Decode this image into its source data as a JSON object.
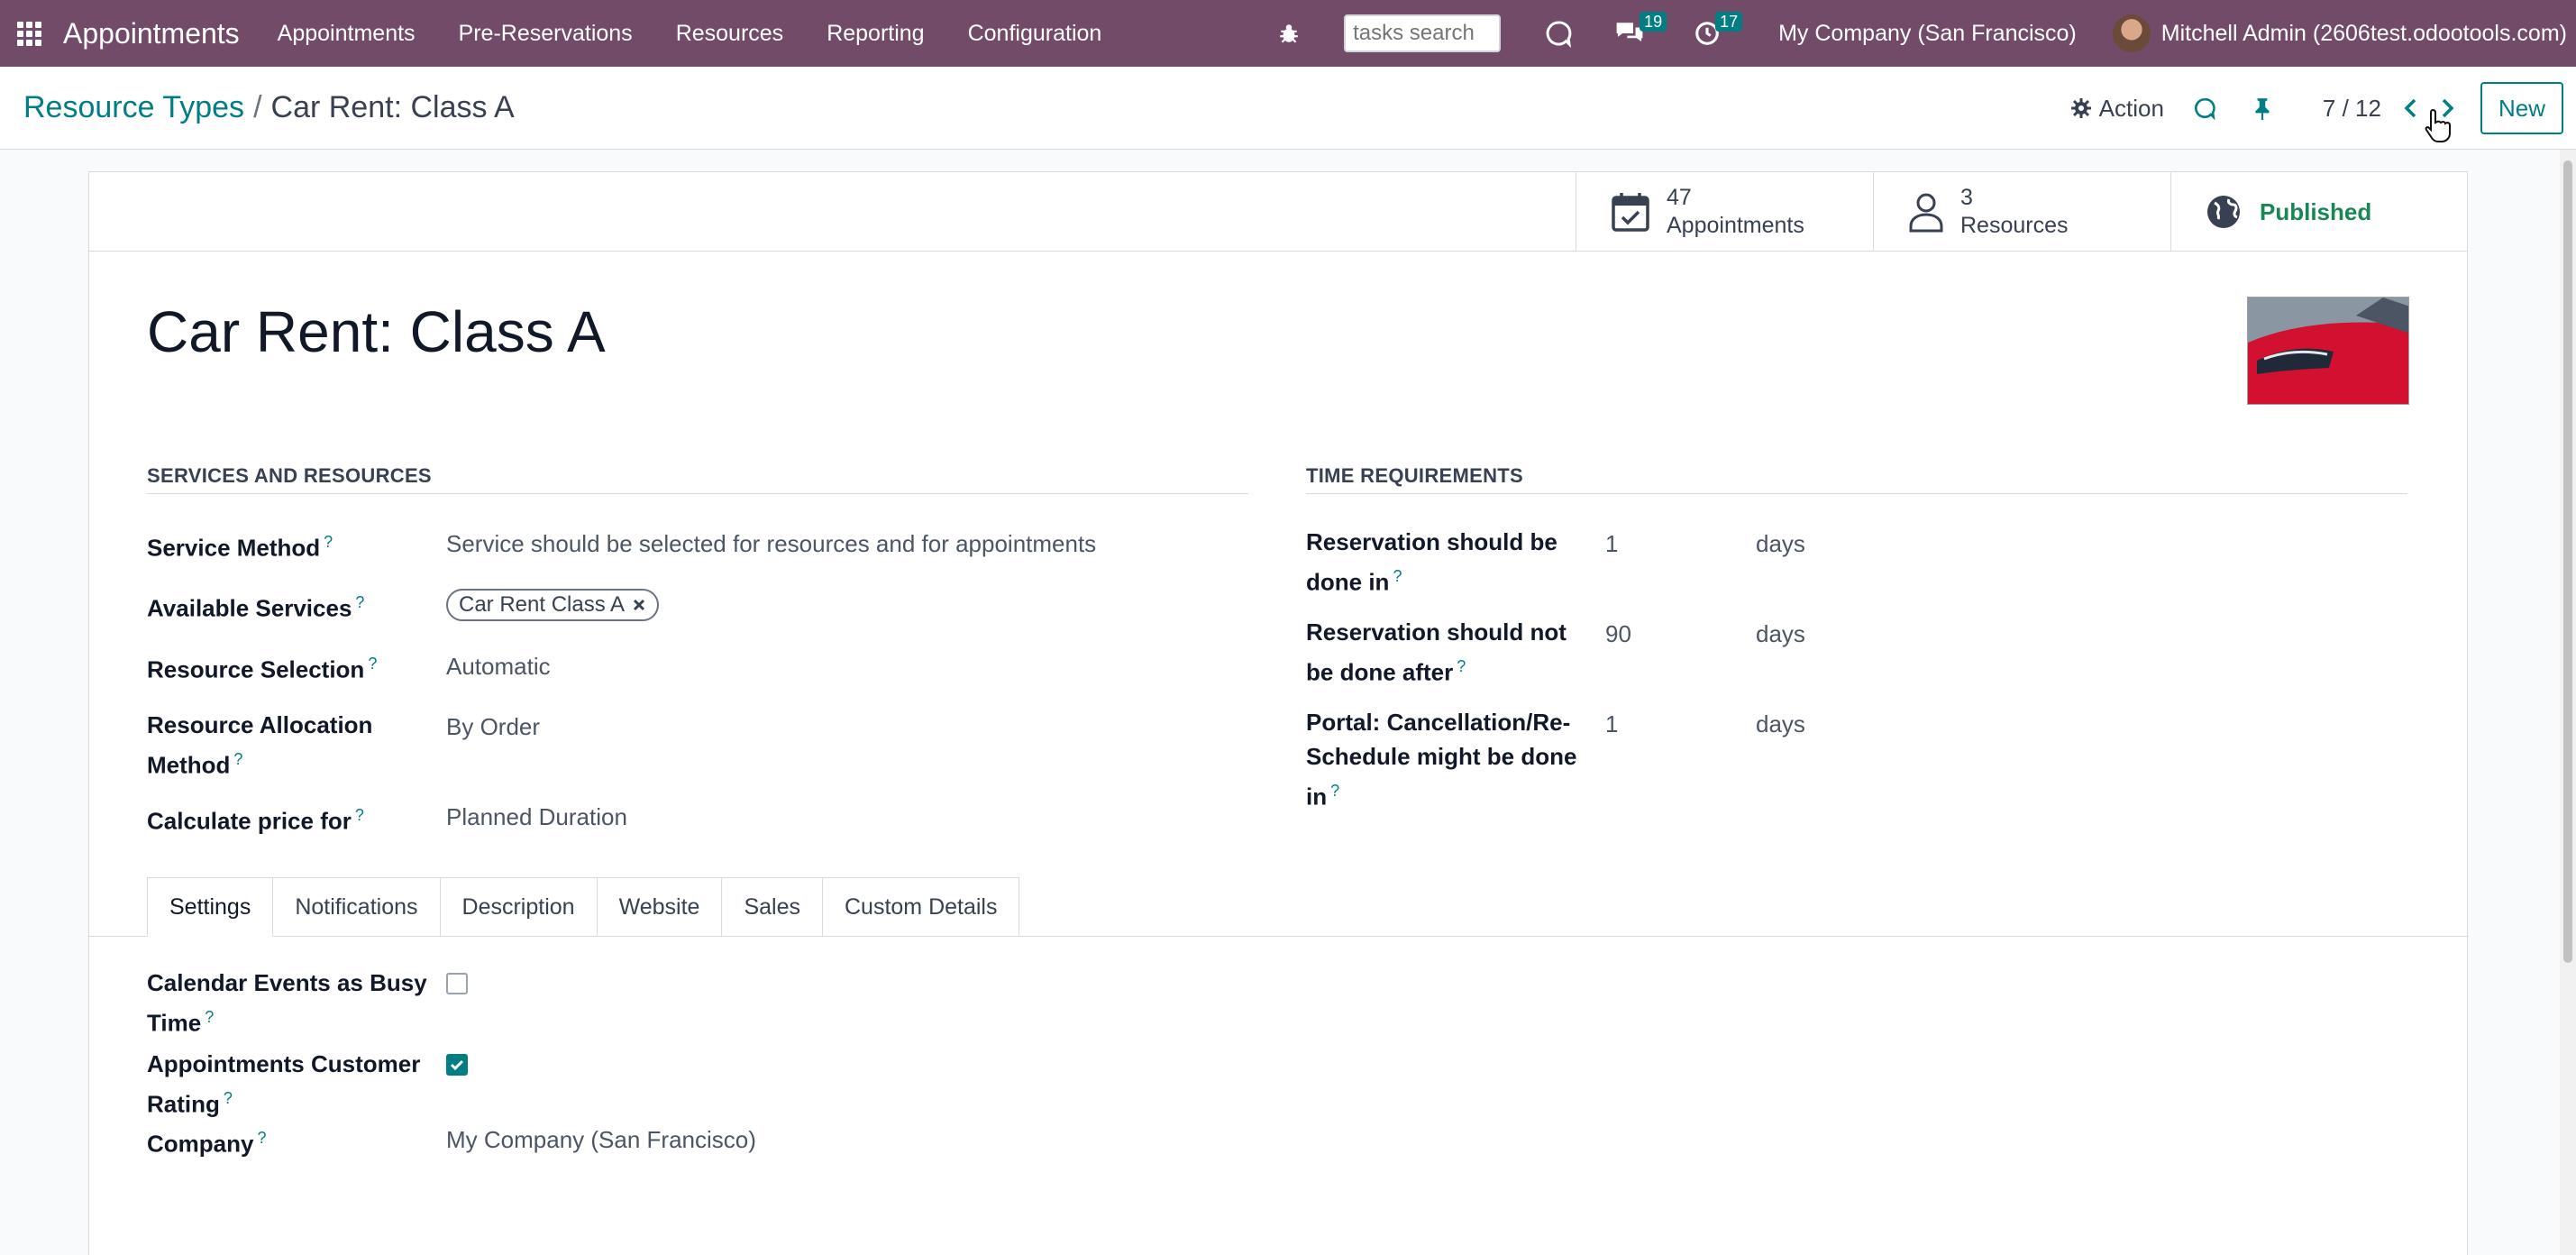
{
  "navbar": {
    "brand": "Appointments",
    "menu": [
      "Appointments",
      "Pre-Reservations",
      "Resources",
      "Reporting",
      "Configuration"
    ],
    "search_placeholder": "tasks search",
    "messages_count": "19",
    "activities_count": "17",
    "company": "My Company (San Francisco)",
    "user": "Mitchell Admin (2606test.odootools.com)"
  },
  "control": {
    "breadcrumb_parent": "Resource Types",
    "breadcrumb_sep": "/",
    "breadcrumb_current": "Car Rent: Class A",
    "action_label": "Action",
    "pager": "7 / 12",
    "new_label": "New"
  },
  "stats": {
    "appointments_count": "47",
    "appointments_label": "Appointments",
    "resources_count": "3",
    "resources_label": "Resources",
    "published_label": "Published"
  },
  "record": {
    "title": "Car Rent: Class A"
  },
  "services": {
    "heading": "SERVICES AND RESOURCES",
    "service_method_label": "Service Method",
    "service_method_value": "Service should be selected for resources and for appointments",
    "available_services_label": "Available Services",
    "available_services_tag": "Car Rent Class A",
    "resource_selection_label": "Resource Selection",
    "resource_selection_value": "Automatic",
    "allocation_label_1": "Resource Allocation",
    "allocation_label_2": "Method",
    "allocation_value": "By Order",
    "price_label": "Calculate price for",
    "price_value": "Planned Duration"
  },
  "time": {
    "heading": "TIME REQUIREMENTS",
    "res_done_in_1": "Reservation should be",
    "res_done_in_2": "done in",
    "res_done_in_value": "1",
    "res_not_after_1": "Reservation should not",
    "res_not_after_2": "be done after",
    "res_not_after_value": "90",
    "portal_1": "Portal: Cancellation/Re-",
    "portal_2": "Schedule might be done",
    "portal_3": "in",
    "portal_value": "1",
    "unit": "days"
  },
  "tabs": [
    "Settings",
    "Notifications",
    "Description",
    "Website",
    "Sales",
    "Custom Details"
  ],
  "settings": {
    "calendar_busy_1": "Calendar Events as Busy",
    "calendar_busy_2": "Time",
    "calendar_busy_checked": false,
    "rating_1": "Appointments Customer",
    "rating_2": "Rating",
    "rating_checked": true,
    "company_label": "Company",
    "company_value": "My Company (San Francisco)"
  },
  "help_mark": "?",
  "colors": {
    "navbar": "#714b67",
    "accent": "#017e84",
    "published": "#198754"
  }
}
